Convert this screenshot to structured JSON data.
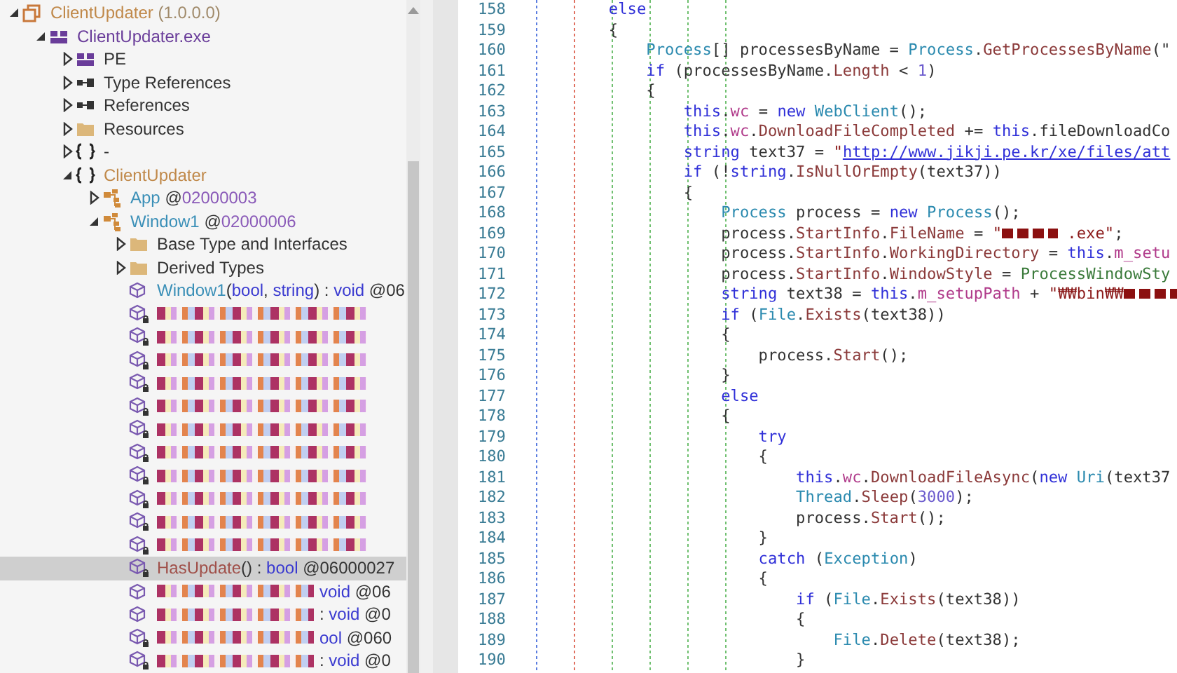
{
  "tree": {
    "items": [
      {
        "kind": "assembly",
        "expanded": true,
        "selected": false,
        "label": [
          {
            "text": "ClientUpdater",
            "kind": "assembly"
          },
          {
            "text": " (1.0.0.0)",
            "kind": "version"
          }
        ],
        "children": [
          {
            "kind": "module",
            "expanded": true,
            "selected": false,
            "label": [
              {
                "text": "ClientUpdater.exe",
                "kind": "module"
              }
            ],
            "children": [
              {
                "kind": "module",
                "expanded": false,
                "selected": false,
                "label": [
                  {
                    "text": "PE",
                    "kind": "plain"
                  }
                ]
              },
              {
                "kind": "refs",
                "expanded": false,
                "selected": false,
                "label": [
                  {
                    "text": "Type References",
                    "kind": "plain"
                  }
                ]
              },
              {
                "kind": "refs",
                "expanded": false,
                "selected": false,
                "label": [
                  {
                    "text": "References",
                    "kind": "plain"
                  }
                ]
              },
              {
                "kind": "folder",
                "expanded": false,
                "selected": false,
                "label": [
                  {
                    "text": "Resources",
                    "kind": "plain"
                  }
                ]
              },
              {
                "kind": "namespace",
                "expanded": false,
                "selected": false,
                "label": [
                  {
                    "text": "-",
                    "kind": "plain"
                  }
                ]
              },
              {
                "kind": "namespace",
                "expanded": true,
                "selected": false,
                "label": [
                  {
                    "text": "ClientUpdater",
                    "kind": "assembly"
                  }
                ],
                "children": [
                  {
                    "kind": "class",
                    "expanded": false,
                    "selected": false,
                    "label": [
                      {
                        "text": "App",
                        "kind": "type"
                      },
                      {
                        "text": " @",
                        "kind": "plain"
                      },
                      {
                        "text": "02000003",
                        "kind": "token"
                      }
                    ]
                  },
                  {
                    "kind": "class",
                    "expanded": true,
                    "selected": false,
                    "label": [
                      {
                        "text": "Window1",
                        "kind": "type"
                      },
                      {
                        "text": " @",
                        "kind": "plain"
                      },
                      {
                        "text": "02000006",
                        "kind": "token"
                      }
                    ],
                    "children": [
                      {
                        "kind": "folder",
                        "expanded": false,
                        "selected": false,
                        "label": [
                          {
                            "text": "Base Type and Interfaces",
                            "kind": "plain"
                          }
                        ]
                      },
                      {
                        "kind": "folder",
                        "expanded": false,
                        "selected": false,
                        "label": [
                          {
                            "text": "Derived Types",
                            "kind": "plain"
                          }
                        ]
                      },
                      {
                        "kind": "method",
                        "selected": false,
                        "redacted": false,
                        "label": [
                          {
                            "text": "Window1",
                            "kind": "type"
                          },
                          {
                            "text": "(",
                            "kind": "plain"
                          },
                          {
                            "text": "bool",
                            "kind": "keyword"
                          },
                          {
                            "text": ", ",
                            "kind": "plain"
                          },
                          {
                            "text": "string",
                            "kind": "keyword"
                          },
                          {
                            "text": ") : ",
                            "kind": "plain"
                          },
                          {
                            "text": "void",
                            "kind": "keyword"
                          },
                          {
                            "text": " @06",
                            "kind": "plain"
                          }
                        ]
                      },
                      {
                        "kind": "private_method",
                        "selected": false,
                        "redacted": true
                      },
                      {
                        "kind": "private_method",
                        "selected": false,
                        "redacted": true
                      },
                      {
                        "kind": "private_method",
                        "selected": false,
                        "redacted": true
                      },
                      {
                        "kind": "private_method",
                        "selected": false,
                        "redacted": true
                      },
                      {
                        "kind": "private_method",
                        "selected": false,
                        "redacted": true
                      },
                      {
                        "kind": "private_method",
                        "selected": false,
                        "redacted": true
                      },
                      {
                        "kind": "private_method",
                        "selected": false,
                        "redacted": true
                      },
                      {
                        "kind": "private_method",
                        "selected": false,
                        "redacted": true
                      },
                      {
                        "kind": "private_method",
                        "selected": false,
                        "redacted": true
                      },
                      {
                        "kind": "private_method",
                        "selected": false,
                        "redacted": true
                      },
                      {
                        "kind": "private_method",
                        "selected": false,
                        "redacted": true
                      },
                      {
                        "kind": "private_method",
                        "selected": true,
                        "redacted": false,
                        "label": [
                          {
                            "text": "HasUpdate",
                            "kind": "method"
                          },
                          {
                            "text": "() : ",
                            "kind": "plain"
                          },
                          {
                            "text": "bool",
                            "kind": "keyword"
                          },
                          {
                            "text": " @06000027",
                            "kind": "plain"
                          }
                        ]
                      },
                      {
                        "kind": "method",
                        "selected": false,
                        "redacted": true,
                        "label": [
                          {
                            "text": "void",
                            "kind": "keyword"
                          },
                          {
                            "text": " @06",
                            "kind": "plain"
                          }
                        ]
                      },
                      {
                        "kind": "method",
                        "selected": false,
                        "redacted": true,
                        "label": [
                          {
                            "text": ": ",
                            "kind": "plain"
                          },
                          {
                            "text": "void",
                            "kind": "keyword"
                          },
                          {
                            "text": " @0",
                            "kind": "plain"
                          }
                        ]
                      },
                      {
                        "kind": "private_method",
                        "selected": false,
                        "redacted": true,
                        "label": [
                          {
                            "text": "ool",
                            "kind": "keyword"
                          },
                          {
                            "text": " @060",
                            "kind": "plain"
                          }
                        ]
                      },
                      {
                        "kind": "private_method",
                        "selected": false,
                        "redacted": true,
                        "label": [
                          {
                            "text": ": ",
                            "kind": "plain"
                          },
                          {
                            "text": "void",
                            "kind": "keyword"
                          },
                          {
                            "text": " @0",
                            "kind": "plain"
                          }
                        ]
                      }
                    ]
                  }
                ]
              }
            ]
          }
        ]
      }
    ]
  },
  "code": {
    "lines": [
      {
        "number": "158",
        "tokens": [
          {
            "text": "        else",
            "kind": "kw"
          }
        ]
      },
      {
        "number": "159",
        "tokens": [
          {
            "text": "        {",
            "kind": "plain"
          }
        ]
      },
      {
        "number": "160",
        "tokens": [
          {
            "text": "            Process",
            "kind": "type"
          },
          {
            "text": "[] processesByName = ",
            "kind": "plain"
          },
          {
            "text": "Process",
            "kind": "type"
          },
          {
            "text": ".",
            "kind": "plain"
          },
          {
            "text": "GetProcessesByName",
            "kind": "method"
          },
          {
            "text": "(\"",
            "kind": "plain"
          }
        ]
      },
      {
        "number": "161",
        "tokens": [
          {
            "text": "            if",
            "kind": "kw"
          },
          {
            "text": " (processesByName.",
            "kind": "plain"
          },
          {
            "text": "Length",
            "kind": "method"
          },
          {
            "text": " < ",
            "kind": "plain"
          },
          {
            "text": "1",
            "kind": "num"
          },
          {
            "text": ")",
            "kind": "plain"
          }
        ]
      },
      {
        "number": "162",
        "tokens": [
          {
            "text": "            {",
            "kind": "plain"
          }
        ]
      },
      {
        "number": "163",
        "tokens": [
          {
            "text": "                this",
            "kind": "kw"
          },
          {
            "text": ".",
            "kind": "plain"
          },
          {
            "text": "wc",
            "kind": "field"
          },
          {
            "text": " = ",
            "kind": "plain"
          },
          {
            "text": "new ",
            "kind": "kw"
          },
          {
            "text": "WebClient",
            "kind": "type"
          },
          {
            "text": "();",
            "kind": "plain"
          }
        ]
      },
      {
        "number": "164",
        "tokens": [
          {
            "text": "                this",
            "kind": "kw"
          },
          {
            "text": ".",
            "kind": "plain"
          },
          {
            "text": "wc",
            "kind": "field"
          },
          {
            "text": ".",
            "kind": "plain"
          },
          {
            "text": "DownloadFileCompleted",
            "kind": "method"
          },
          {
            "text": " += ",
            "kind": "plain"
          },
          {
            "text": "this",
            "kind": "kw"
          },
          {
            "text": ".fileDownloadCo",
            "kind": "plain"
          }
        ]
      },
      {
        "number": "165",
        "tokens": [
          {
            "text": "                string",
            "kind": "kw"
          },
          {
            "text": " text37 = ",
            "kind": "plain"
          },
          {
            "text": "\"",
            "kind": "str"
          },
          {
            "text": "http://www.jikji.pe.kr/xe/files/att",
            "kind": "link"
          }
        ]
      },
      {
        "number": "166",
        "tokens": [
          {
            "text": "                if",
            "kind": "kw"
          },
          {
            "text": " (!",
            "kind": "plain"
          },
          {
            "text": "string",
            "kind": "kw"
          },
          {
            "text": ".",
            "kind": "plain"
          },
          {
            "text": "IsNullOrEmpty",
            "kind": "method"
          },
          {
            "text": "(text37))",
            "kind": "plain"
          }
        ]
      },
      {
        "number": "167",
        "tokens": [
          {
            "text": "                {",
            "kind": "plain"
          }
        ]
      },
      {
        "number": "168",
        "tokens": [
          {
            "text": "                    Process",
            "kind": "type"
          },
          {
            "text": " process = ",
            "kind": "plain"
          },
          {
            "text": "new ",
            "kind": "kw"
          },
          {
            "text": "Process",
            "kind": "type"
          },
          {
            "text": "();",
            "kind": "plain"
          }
        ]
      },
      {
        "number": "169",
        "tokens": [
          {
            "text": "                    process.",
            "kind": "plain"
          },
          {
            "text": "StartInfo",
            "kind": "method"
          },
          {
            "text": ".",
            "kind": "plain"
          },
          {
            "text": "FileName",
            "kind": "method"
          },
          {
            "text": " = ",
            "kind": "plain"
          },
          {
            "text": "\"",
            "kind": "str"
          },
          {
            "kind": "redacted"
          },
          {
            "text": " .exe\"",
            "kind": "str"
          },
          {
            "text": ";",
            "kind": "plain"
          }
        ]
      },
      {
        "number": "170",
        "tokens": [
          {
            "text": "                    process.",
            "kind": "plain"
          },
          {
            "text": "StartInfo",
            "kind": "method"
          },
          {
            "text": ".",
            "kind": "plain"
          },
          {
            "text": "WorkingDirectory",
            "kind": "method"
          },
          {
            "text": " = ",
            "kind": "plain"
          },
          {
            "text": "this",
            "kind": "kw"
          },
          {
            "text": ".",
            "kind": "plain"
          },
          {
            "text": "m_setu",
            "kind": "field"
          }
        ]
      },
      {
        "number": "171",
        "tokens": [
          {
            "text": "                    process.",
            "kind": "plain"
          },
          {
            "text": "StartInfo",
            "kind": "method"
          },
          {
            "text": ".",
            "kind": "plain"
          },
          {
            "text": "WindowStyle",
            "kind": "method"
          },
          {
            "text": " = ",
            "kind": "plain"
          },
          {
            "text": "ProcessWindowSty",
            "kind": "enum"
          }
        ]
      },
      {
        "number": "172",
        "tokens": [
          {
            "text": "                    string",
            "kind": "kw"
          },
          {
            "text": " text38 = ",
            "kind": "plain"
          },
          {
            "text": "this",
            "kind": "kw"
          },
          {
            "text": ".",
            "kind": "plain"
          },
          {
            "text": "m_setupPath",
            "kind": "field"
          },
          {
            "text": " + ",
            "kind": "plain"
          },
          {
            "text": "\"₩₩bin₩₩",
            "kind": "str"
          },
          {
            "kind": "redacted"
          }
        ]
      },
      {
        "number": "173",
        "tokens": [
          {
            "text": "                    if",
            "kind": "kw"
          },
          {
            "text": " (",
            "kind": "plain"
          },
          {
            "text": "File",
            "kind": "type"
          },
          {
            "text": ".",
            "kind": "plain"
          },
          {
            "text": "Exists",
            "kind": "method"
          },
          {
            "text": "(text38))",
            "kind": "plain"
          }
        ]
      },
      {
        "number": "174",
        "tokens": [
          {
            "text": "                    {",
            "kind": "plain"
          }
        ]
      },
      {
        "number": "175",
        "tokens": [
          {
            "text": "                        process.",
            "kind": "plain"
          },
          {
            "text": "Start",
            "kind": "method"
          },
          {
            "text": "();",
            "kind": "plain"
          }
        ]
      },
      {
        "number": "176",
        "tokens": [
          {
            "text": "                    }",
            "kind": "plain"
          }
        ]
      },
      {
        "number": "177",
        "tokens": [
          {
            "text": "                    else",
            "kind": "kw"
          }
        ]
      },
      {
        "number": "178",
        "tokens": [
          {
            "text": "                    {",
            "kind": "plain"
          }
        ]
      },
      {
        "number": "179",
        "tokens": [
          {
            "text": "                        try",
            "kind": "kw"
          }
        ]
      },
      {
        "number": "180",
        "tokens": [
          {
            "text": "                        {",
            "kind": "plain"
          }
        ]
      },
      {
        "number": "181",
        "tokens": [
          {
            "text": "                            this",
            "kind": "kw"
          },
          {
            "text": ".",
            "kind": "plain"
          },
          {
            "text": "wc",
            "kind": "field"
          },
          {
            "text": ".",
            "kind": "plain"
          },
          {
            "text": "DownloadFileAsync",
            "kind": "method"
          },
          {
            "text": "(",
            "kind": "plain"
          },
          {
            "text": "new ",
            "kind": "kw"
          },
          {
            "text": "Uri",
            "kind": "type"
          },
          {
            "text": "(text37",
            "kind": "plain"
          }
        ]
      },
      {
        "number": "182",
        "tokens": [
          {
            "text": "                            Thread",
            "kind": "type"
          },
          {
            "text": ".",
            "kind": "plain"
          },
          {
            "text": "Sleep",
            "kind": "method"
          },
          {
            "text": "(",
            "kind": "plain"
          },
          {
            "text": "3000",
            "kind": "num"
          },
          {
            "text": ");",
            "kind": "plain"
          }
        ]
      },
      {
        "number": "183",
        "tokens": [
          {
            "text": "                            process.",
            "kind": "plain"
          },
          {
            "text": "Start",
            "kind": "method"
          },
          {
            "text": "();",
            "kind": "plain"
          }
        ]
      },
      {
        "number": "184",
        "tokens": [
          {
            "text": "                        }",
            "kind": "plain"
          }
        ]
      },
      {
        "number": "185",
        "tokens": [
          {
            "text": "                        catch",
            "kind": "kw"
          },
          {
            "text": " (",
            "kind": "plain"
          },
          {
            "text": "Exception",
            "kind": "type"
          },
          {
            "text": ")",
            "kind": "plain"
          }
        ]
      },
      {
        "number": "186",
        "tokens": [
          {
            "text": "                        {",
            "kind": "plain"
          }
        ]
      },
      {
        "number": "187",
        "tokens": [
          {
            "text": "                            if",
            "kind": "kw"
          },
          {
            "text": " (",
            "kind": "plain"
          },
          {
            "text": "File",
            "kind": "type"
          },
          {
            "text": ".",
            "kind": "plain"
          },
          {
            "text": "Exists",
            "kind": "method"
          },
          {
            "text": "(text38))",
            "kind": "plain"
          }
        ]
      },
      {
        "number": "188",
        "tokens": [
          {
            "text": "                            {",
            "kind": "plain"
          }
        ]
      },
      {
        "number": "189",
        "tokens": [
          {
            "text": "                                File",
            "kind": "type"
          },
          {
            "text": ".",
            "kind": "plain"
          },
          {
            "text": "Delete",
            "kind": "method"
          },
          {
            "text": "(text38);",
            "kind": "plain"
          }
        ]
      },
      {
        "number": "190",
        "tokens": [
          {
            "text": "                            }",
            "kind": "plain"
          }
        ]
      }
    ]
  }
}
